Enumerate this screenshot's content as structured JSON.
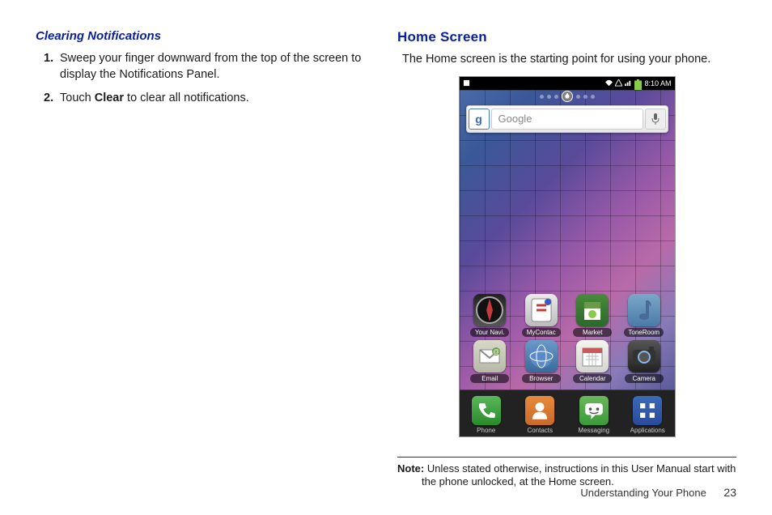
{
  "left": {
    "heading": "Clearing Notifications",
    "steps": [
      {
        "num": "1.",
        "text_a": "Sweep your finger downward from the top of the screen to display the Notifications Panel."
      },
      {
        "num": "2.",
        "text_a": "Touch ",
        "bold": "Clear",
        "text_b": " to clear all notifications."
      }
    ]
  },
  "right": {
    "heading": "Home Screen",
    "intro": "The Home screen is the starting point for using your phone.",
    "note_label": "Note:",
    "note_text": " Unless stated otherwise, instructions in this User Manual start with the phone unlocked, at the Home screen."
  },
  "phone": {
    "time": "8:10 AM",
    "page_number": "4",
    "search_placeholder": "Google",
    "row1": [
      {
        "label": "Your Navi.",
        "bg": "linear-gradient(#222,#555)",
        "glyph": "compass"
      },
      {
        "label": "MyContac",
        "bg": "linear-gradient(#eaeaea,#bcbcbc)",
        "glyph": "mycontact"
      },
      {
        "label": "Market",
        "bg": "linear-gradient(#4a8a3a,#2a6a2a)",
        "glyph": "market"
      },
      {
        "label": "ToneRoom",
        "bg": "linear-gradient(#7aa8c8,#4a7aa8)",
        "glyph": "music"
      }
    ],
    "row2": [
      {
        "label": "Email",
        "bg": "linear-gradient(#d8d8c8,#b8b8a8)",
        "glyph": "email"
      },
      {
        "label": "Browser",
        "bg": "linear-gradient(#6a9ac8,#3a6a9a)",
        "glyph": "globe"
      },
      {
        "label": "Calendar",
        "bg": "linear-gradient(#f5f5f0,#d5d5d0)",
        "glyph": "calendar"
      },
      {
        "label": "Camera",
        "bg": "linear-gradient(#555,#222)",
        "glyph": "camera"
      }
    ],
    "dock": [
      {
        "label": "Phone",
        "bg": "linear-gradient(#5ab85a,#2a8a2a)",
        "glyph": "phone"
      },
      {
        "label": "Contacts",
        "bg": "linear-gradient(#e88a3a,#c86a2a)",
        "glyph": "person"
      },
      {
        "label": "Messaging",
        "bg": "linear-gradient(#6ab85a,#3a9a3a)",
        "glyph": "chat"
      },
      {
        "label": "Applications",
        "bg": "linear-gradient(#3a6ab8,#2a4a9a)",
        "glyph": "grid"
      }
    ]
  },
  "footer": {
    "section": "Understanding Your Phone",
    "page": "23"
  }
}
